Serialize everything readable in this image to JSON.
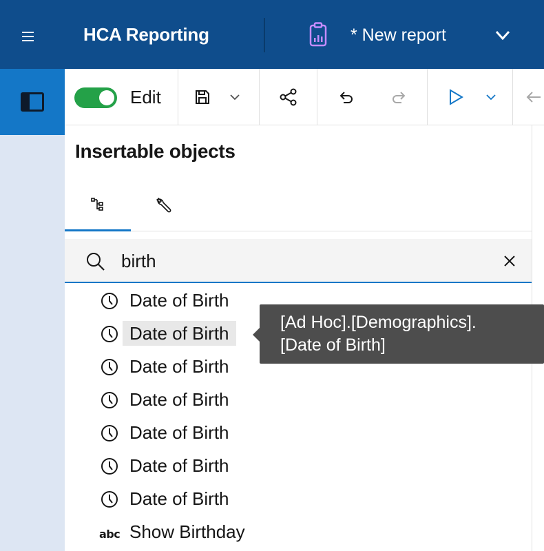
{
  "header": {
    "menu_icon": "hamburger-menu-icon",
    "app_title": "HCA Reporting",
    "report_icon": "report-clipboard-icon",
    "report_title": "* New report",
    "chevron_icon": "chevron-down-icon",
    "background": "#0f4d8c"
  },
  "toolbar": {
    "edit_toggle_on": true,
    "edit_label": "Edit",
    "icons": [
      "save-icon",
      "chevron-down-icon",
      "share-icon",
      "undo-icon",
      "redo-icon",
      "run-icon",
      "chevron-down-icon",
      "back-arrow-icon"
    ],
    "toggle_color": "#24a148"
  },
  "left_rail": {
    "panel_toggle_icon": "side-panel-icon",
    "accent": "#1477c7"
  },
  "panel": {
    "title": "Insertable objects",
    "tabs": [
      {
        "icon": "source-tree-icon",
        "active": true
      },
      {
        "icon": "toolbox-wrench-icon",
        "active": false
      }
    ],
    "search": {
      "value": "birth",
      "search_icon": "search-icon",
      "clear_icon": "close-icon"
    },
    "results": [
      {
        "label": "Date of Birth",
        "icon": "clock-icon"
      },
      {
        "label": "Date of Birth",
        "icon": "clock-icon",
        "hovered": true
      },
      {
        "label": "Date of Birth",
        "icon": "clock-icon"
      },
      {
        "label": "Date of Birth",
        "icon": "clock-icon"
      },
      {
        "label": "Date of Birth",
        "icon": "clock-icon"
      },
      {
        "label": "Date of Birth",
        "icon": "clock-icon"
      },
      {
        "label": "Date of Birth",
        "icon": "clock-icon"
      },
      {
        "label": "Show Birthday",
        "icon": "abc-text-icon",
        "icon_text": "abc"
      }
    ]
  },
  "tooltip": {
    "line1": "[Ad Hoc].[Demographics].",
    "line2": "[Date of Birth]"
  }
}
